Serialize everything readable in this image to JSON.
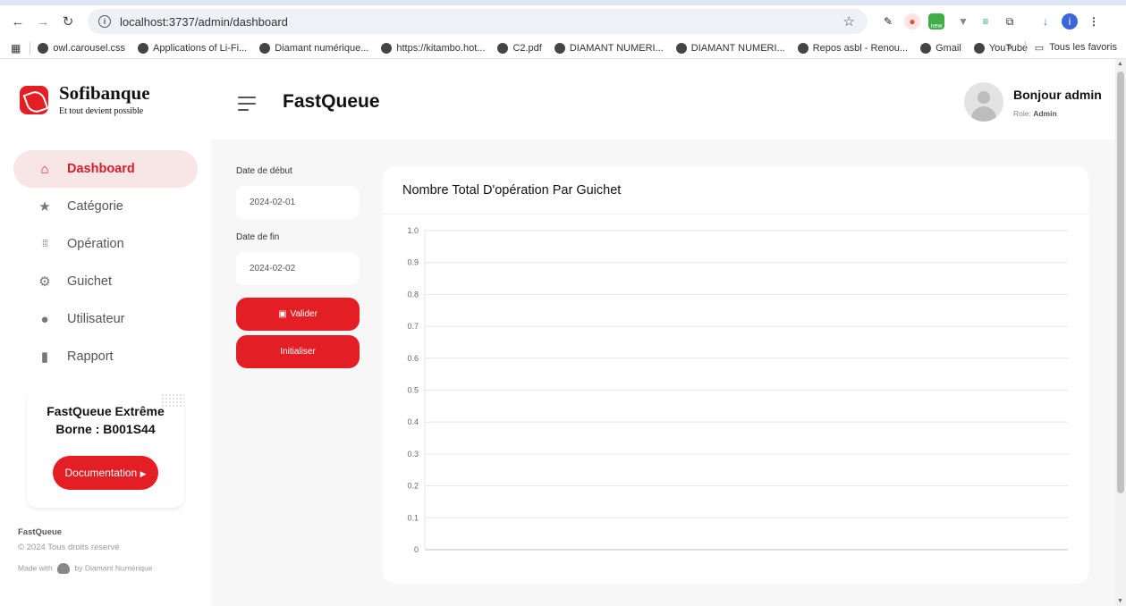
{
  "browser": {
    "url": "localhost:3737/admin/dashboard",
    "bookmarks": [
      "owl.carousel.css",
      "Applications of Li-Fi...",
      "Diamant numérique...",
      "https://kitambo.hot...",
      "C2.pdf",
      "DIAMANT NUMERI...",
      "DIAMANT NUMERI...",
      "Repos asbl - Renou...",
      "Gmail",
      "YouTube"
    ],
    "more_label": "»",
    "all_bookmarks_label": "Tous les favoris",
    "profile_initial": "i",
    "ext_new_badge": "new"
  },
  "brand": {
    "name": "Sofibanque",
    "tagline": "Et tout devient possible"
  },
  "menu": [
    {
      "label": "Dashboard",
      "icon": "home-icon"
    },
    {
      "label": "Catégorie",
      "icon": "star-icon"
    },
    {
      "label": "Opération",
      "icon": "grid-dots-icon"
    },
    {
      "label": "Guichet",
      "icon": "gear-icon"
    },
    {
      "label": "Utilisateur",
      "icon": "user-icon"
    },
    {
      "label": "Rapport",
      "icon": "file-icon"
    }
  ],
  "promo": {
    "line1": "FastQueue Extrême",
    "line2": "Borne : B001S44",
    "button": "Documentation"
  },
  "footer": {
    "app": "FastQueue",
    "copyright": "© 2024 Tous droits reservé",
    "made_with": "Made with",
    "by": "by Diamant Numérique"
  },
  "header": {
    "title": "FastQueue",
    "greeting": "Bonjour admin",
    "role_label": "Role:",
    "role_value": "Admin"
  },
  "filters": {
    "start_label": "Date de début",
    "start_value": "2024-02-01",
    "end_label": "Date de fin",
    "end_value": "2024-02-02",
    "validate_label": "Valider",
    "reset_label": "Initialiser"
  },
  "colors": {
    "accent": "#e31e24",
    "active_bg": "#f8e6e7",
    "page_bg": "#f7f7f7"
  },
  "chart_data": {
    "type": "bar",
    "title": "Nombre Total D'opération Par Guichet",
    "categories": [],
    "series": [],
    "ylim": [
      0,
      1
    ],
    "yticks": [
      "1.0",
      "0.9",
      "0.8",
      "0.7",
      "0.6",
      "0.5",
      "0.4",
      "0.3",
      "0.2",
      "0.1",
      "0"
    ],
    "grid": true
  }
}
